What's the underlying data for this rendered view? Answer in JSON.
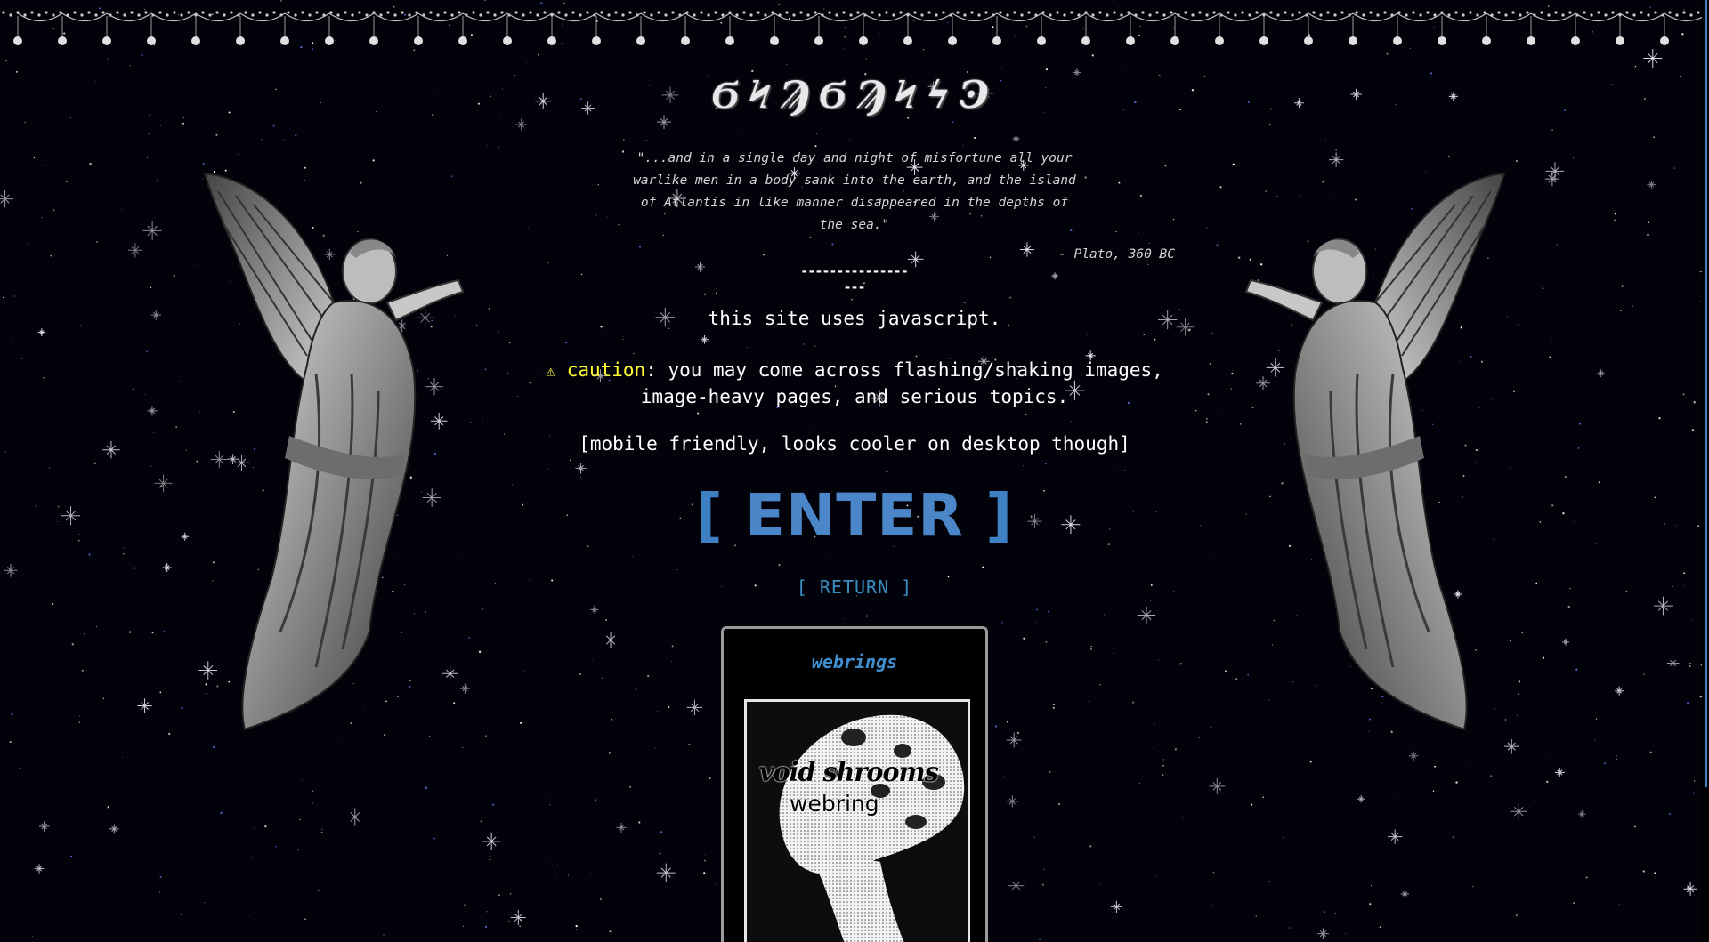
{
  "site": {
    "logo_text": "ϬϞϠϬϠϞϟϿ"
  },
  "quote": {
    "text": "\"...and in a single day and night of misfortune all your warlike men in a body sank into the earth, and the island of Atlantis in like manner disappeared in the depths of the sea.\"",
    "author": "- Plato, 360 BC"
  },
  "divider": "------------------",
  "notices": {
    "javascript": "this site uses javascript.",
    "caution_icon": "⚠",
    "caution_word": "caution",
    "caution_rest_line1": ": you may come across flashing/shaking images,",
    "caution_line2": "image-heavy pages, and serious topics.",
    "mobile": "[mobile friendly, looks cooler on desktop though]"
  },
  "links": {
    "enter_open": "[ ",
    "enter_word": "ENTER",
    "enter_close": " ]",
    "return": "[ RETURN ]"
  },
  "webrings": {
    "title": "webrings",
    "banner_title": "void shrooms",
    "banner_subtitle": "webring"
  },
  "colors": {
    "background": "#02020a",
    "caution": "#ffff33",
    "link_blue": "#3f7fc4",
    "webring_title": "#3f8fd0"
  },
  "icons": {
    "decoration_top": "garland-border-icon",
    "left_angel": "angel-statue-icon",
    "right_angel": "angel-statue-icon",
    "warning": "warning-triangle-icon",
    "banner_art": "mushroom-icon"
  }
}
